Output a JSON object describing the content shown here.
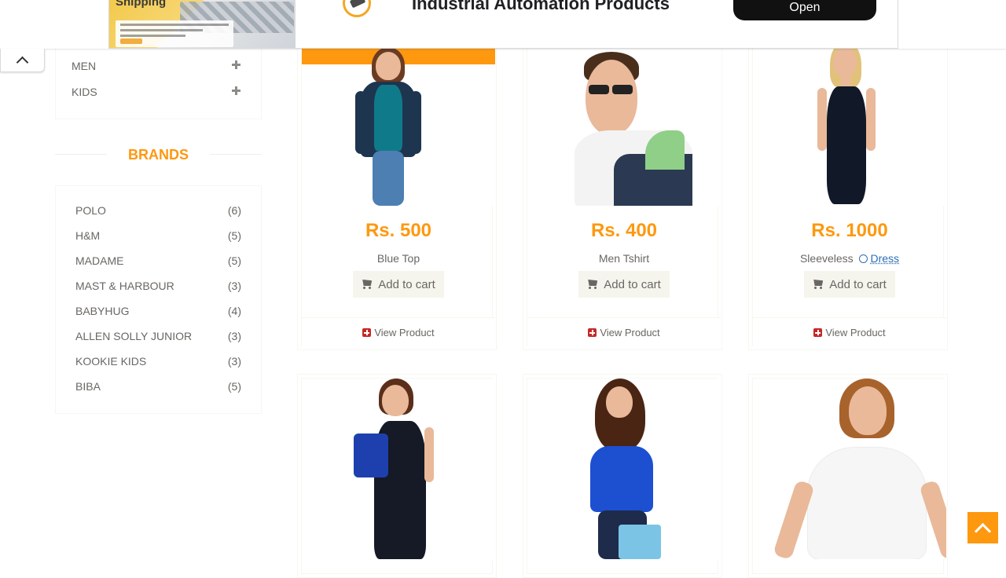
{
  "ad": {
    "image_title": "Shipping",
    "headline": "Industrial Automation Products",
    "open_label": "Open"
  },
  "categories": [
    {
      "label": "MEN"
    },
    {
      "label": "KIDS"
    }
  ],
  "brands": {
    "title": "BRANDS",
    "items": [
      {
        "name": "POLO",
        "count": "(6)"
      },
      {
        "name": "H&M",
        "count": "(5)"
      },
      {
        "name": "MADAME",
        "count": "(5)"
      },
      {
        "name": "MAST & HARBOUR",
        "count": "(3)"
      },
      {
        "name": "BABYHUG",
        "count": "(4)"
      },
      {
        "name": "ALLEN SOLLY JUNIOR",
        "count": "(3)"
      },
      {
        "name": "KOOKIE KIDS",
        "count": "(3)"
      },
      {
        "name": "BIBA",
        "count": "(5)"
      }
    ]
  },
  "products": [
    {
      "price": "Rs. 500",
      "name": "Blue Top",
      "cart_label": "Add to cart",
      "view_label": "View Product"
    },
    {
      "price": "Rs. 400",
      "name": "Men Tshirt",
      "cart_label": "Add to cart",
      "view_label": "View Product"
    },
    {
      "price": "Rs. 1000",
      "name": "Sleeveless",
      "name_link": "Dress",
      "cart_label": "Add to cart",
      "view_label": "View Product"
    }
  ],
  "colors": {
    "accent": "#fe980f",
    "text": "#696763",
    "view_icon": "#c62828",
    "link": "#2c6fb7"
  }
}
